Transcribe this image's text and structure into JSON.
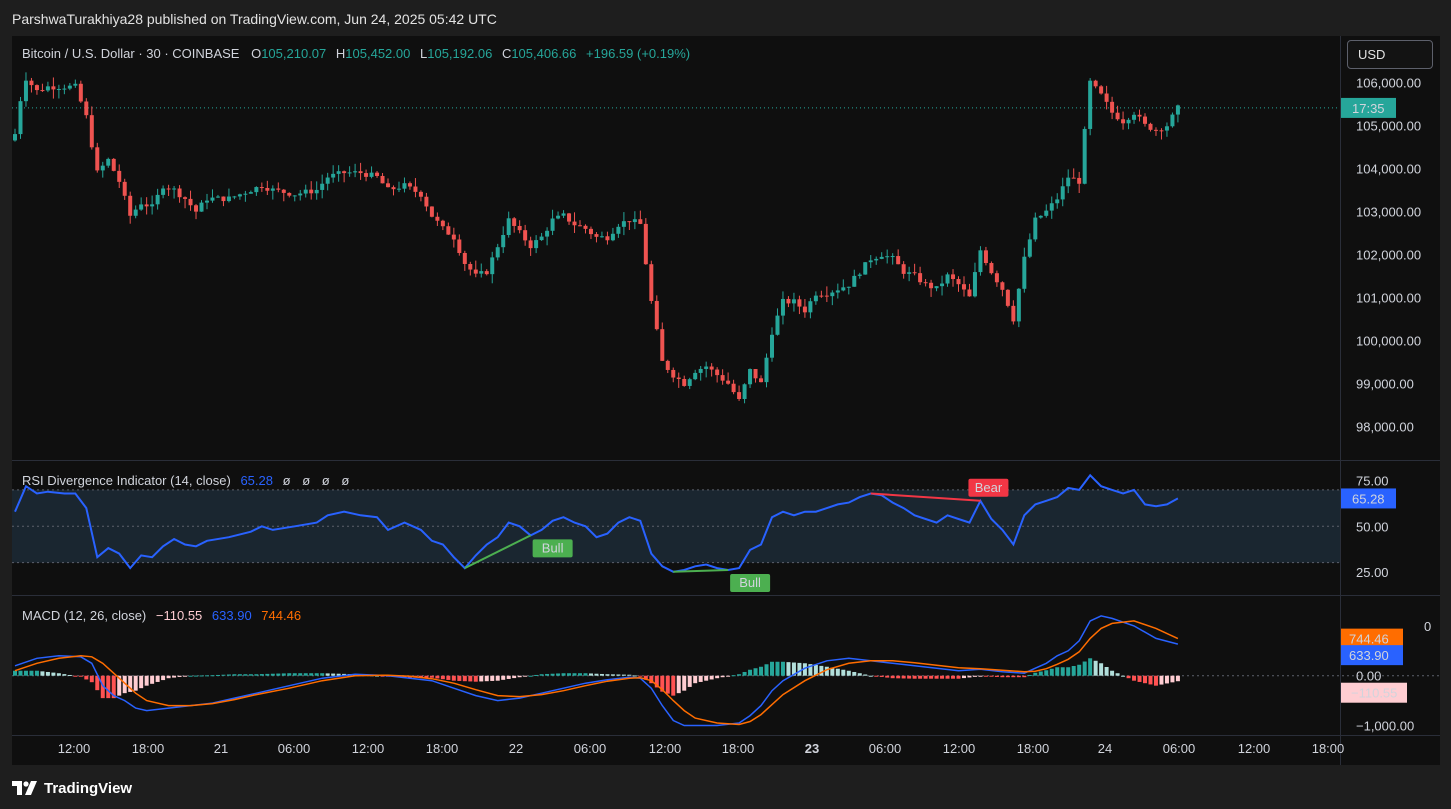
{
  "header": {
    "publish_text": "ParshwaTurakhiya28 published on TradingView.com, Jun 24, 2025 05:42 UTC"
  },
  "footer": {
    "brand": "TradingView"
  },
  "currency": "USD",
  "colors": {
    "up": "#26a69a",
    "down": "#ef5350",
    "rsi": "#2962ff",
    "macd": "#2962ff",
    "signal": "#ff6d00",
    "bull": "#4caf50",
    "bear": "#f23645"
  },
  "chart_data": [
    {
      "type": "candlestick",
      "title": "Bitcoin / U.S. Dollar · 30 · COINBASE",
      "ohlc_label": {
        "o_label": "O",
        "o": "105,210.07",
        "h_label": "H",
        "h": "105,452.00",
        "l_label": "L",
        "l": "105,192.06",
        "c_label": "C",
        "c": "105,406.66",
        "change": "+196.59 (+0.19%)"
      },
      "ylim": [
        97500,
        106800
      ],
      "y_ticks": [
        "106,000.00",
        "105,000.00",
        "104,000.00",
        "103,000.00",
        "102,000.00",
        "101,000.00",
        "100,000.00",
        "99,000.00",
        "98,000.00"
      ],
      "y_tick_values": [
        106000,
        105000,
        104000,
        103000,
        102000,
        101000,
        100000,
        99000,
        98000
      ],
      "last_price": 105407,
      "countdown_label": "17:35",
      "x_ticks": [
        "12:00",
        "18:00",
        "21",
        "06:00",
        "12:00",
        "18:00",
        "22",
        "06:00",
        "12:00",
        "18:00",
        "23",
        "06:00",
        "12:00",
        "18:00",
        "24",
        "06:00",
        "12:00",
        "18:00"
      ],
      "close_path": [
        [
          0,
          104800
        ],
        [
          1,
          105600
        ],
        [
          2,
          106100
        ],
        [
          4,
          105800
        ],
        [
          6,
          105900
        ],
        [
          9,
          105900
        ],
        [
          11,
          105900
        ],
        [
          13,
          105200
        ],
        [
          15,
          103900
        ],
        [
          17,
          104200
        ],
        [
          19,
          103700
        ],
        [
          21,
          102900
        ],
        [
          23,
          103200
        ],
        [
          25,
          103100
        ],
        [
          27,
          103600
        ],
        [
          29,
          103500
        ],
        [
          31,
          103300
        ],
        [
          33,
          103000
        ],
        [
          35,
          103300
        ],
        [
          39,
          103300
        ],
        [
          43,
          103500
        ],
        [
          45,
          103600
        ],
        [
          47,
          103500
        ],
        [
          51,
          103400
        ],
        [
          55,
          103500
        ],
        [
          57,
          103800
        ],
        [
          60,
          103900
        ],
        [
          63,
          103900
        ],
        [
          66,
          103800
        ],
        [
          68,
          103500
        ],
        [
          71,
          103600
        ],
        [
          74,
          103400
        ],
        [
          76,
          102900
        ],
        [
          78,
          102600
        ],
        [
          80,
          102400
        ],
        [
          82,
          101800
        ],
        [
          84,
          101500
        ],
        [
          86,
          101600
        ],
        [
          88,
          102200
        ],
        [
          90,
          102800
        ],
        [
          92,
          102500
        ],
        [
          94,
          102200
        ],
        [
          96,
          102400
        ],
        [
          98,
          102800
        ],
        [
          100,
          102900
        ],
        [
          102,
          102700
        ],
        [
          104,
          102600
        ],
        [
          106,
          102400
        ],
        [
          108,
          102400
        ],
        [
          110,
          102700
        ],
        [
          112,
          102800
        ],
        [
          114,
          102700
        ],
        [
          116,
          100900
        ],
        [
          118,
          99500
        ],
        [
          120,
          99200
        ],
        [
          122,
          99000
        ],
        [
          124,
          99300
        ],
        [
          126,
          99400
        ],
        [
          128,
          99200
        ],
        [
          130,
          99000
        ],
        [
          132,
          98600
        ],
        [
          134,
          99300
        ],
        [
          136,
          99000
        ],
        [
          138,
          100200
        ],
        [
          140,
          100900
        ],
        [
          142,
          100900
        ],
        [
          144,
          100700
        ],
        [
          146,
          101100
        ],
        [
          148,
          101100
        ],
        [
          150,
          101200
        ],
        [
          152,
          101300
        ],
        [
          154,
          101600
        ],
        [
          156,
          101900
        ],
        [
          158,
          102000
        ],
        [
          160,
          101900
        ],
        [
          162,
          101600
        ],
        [
          164,
          101500
        ],
        [
          166,
          101300
        ],
        [
          168,
          101200
        ],
        [
          170,
          101500
        ],
        [
          172,
          101300
        ],
        [
          174,
          101000
        ],
        [
          176,
          102100
        ],
        [
          178,
          101600
        ],
        [
          180,
          101200
        ],
        [
          182,
          100500
        ],
        [
          184,
          101900
        ],
        [
          186,
          102800
        ],
        [
          188,
          103000
        ],
        [
          190,
          103300
        ],
        [
          192,
          103800
        ],
        [
          194,
          103700
        ],
        [
          196,
          106000
        ],
        [
          198,
          105700
        ],
        [
          200,
          105300
        ],
        [
          202,
          105100
        ],
        [
          204,
          105300
        ],
        [
          206,
          105000
        ],
        [
          208,
          104900
        ],
        [
          210,
          105000
        ],
        [
          212,
          105400
        ]
      ]
    },
    {
      "type": "line",
      "title": "RSI Divergence Indicator (14, close)",
      "value_label": "65.28",
      "na_labels": [
        "ø",
        "ø",
        "ø",
        "ø"
      ],
      "ylim": [
        15,
        82
      ],
      "y_ticks": [
        "75.00",
        "50.00",
        "25.00"
      ],
      "y_tick_values": [
        75,
        50,
        25
      ],
      "band": [
        30,
        70
      ],
      "midline": 50,
      "last_value": 65.28,
      "series": [
        [
          0,
          58
        ],
        [
          2,
          72
        ],
        [
          4,
          68
        ],
        [
          6,
          69
        ],
        [
          9,
          68
        ],
        [
          11,
          68
        ],
        [
          13,
          60
        ],
        [
          15,
          33
        ],
        [
          17,
          38
        ],
        [
          19,
          35
        ],
        [
          21,
          27
        ],
        [
          23,
          34
        ],
        [
          25,
          33
        ],
        [
          27,
          39
        ],
        [
          29,
          43
        ],
        [
          31,
          40
        ],
        [
          33,
          39
        ],
        [
          35,
          42
        ],
        [
          39,
          44
        ],
        [
          43,
          47
        ],
        [
          45,
          50
        ],
        [
          47,
          48
        ],
        [
          51,
          50
        ],
        [
          55,
          52
        ],
        [
          57,
          56
        ],
        [
          60,
          58
        ],
        [
          63,
          56
        ],
        [
          66,
          55
        ],
        [
          68,
          48
        ],
        [
          71,
          52
        ],
        [
          74,
          48
        ],
        [
          76,
          42
        ],
        [
          78,
          40
        ],
        [
          80,
          33
        ],
        [
          82,
          27
        ],
        [
          84,
          34
        ],
        [
          86,
          40
        ],
        [
          88,
          44
        ],
        [
          90,
          52
        ],
        [
          92,
          50
        ],
        [
          94,
          45
        ],
        [
          96,
          48
        ],
        [
          98,
          53
        ],
        [
          100,
          55
        ],
        [
          102,
          52
        ],
        [
          104,
          50
        ],
        [
          106,
          44
        ],
        [
          108,
          46
        ],
        [
          110,
          52
        ],
        [
          112,
          55
        ],
        [
          114,
          53
        ],
        [
          116,
          35
        ],
        [
          118,
          28
        ],
        [
          120,
          25
        ],
        [
          122,
          26
        ],
        [
          124,
          28
        ],
        [
          126,
          29
        ],
        [
          128,
          27
        ],
        [
          130,
          26
        ],
        [
          132,
          27
        ],
        [
          134,
          37
        ],
        [
          136,
          40
        ],
        [
          138,
          55
        ],
        [
          140,
          58
        ],
        [
          142,
          56
        ],
        [
          144,
          58
        ],
        [
          146,
          58
        ],
        [
          148,
          60
        ],
        [
          150,
          62
        ],
        [
          152,
          63
        ],
        [
          154,
          66
        ],
        [
          156,
          68
        ],
        [
          158,
          67
        ],
        [
          160,
          63
        ],
        [
          162,
          60
        ],
        [
          164,
          56
        ],
        [
          166,
          54
        ],
        [
          168,
          52
        ],
        [
          170,
          56
        ],
        [
          172,
          54
        ],
        [
          174,
          52
        ],
        [
          176,
          64
        ],
        [
          178,
          54
        ],
        [
          180,
          48
        ],
        [
          182,
          40
        ],
        [
          184,
          56
        ],
        [
          186,
          62
        ],
        [
          188,
          64
        ],
        [
          190,
          66
        ],
        [
          192,
          71
        ],
        [
          194,
          70
        ],
        [
          196,
          78
        ],
        [
          198,
          72
        ],
        [
          200,
          70
        ],
        [
          202,
          68
        ],
        [
          204,
          70
        ],
        [
          206,
          62
        ],
        [
          208,
          61
        ],
        [
          210,
          62
        ],
        [
          212,
          65.28
        ]
      ],
      "divergences": [
        {
          "label": "Bull",
          "from": [
            82,
            27
          ],
          "to": [
            94,
            45
          ]
        },
        {
          "label": "Bull",
          "from": [
            120,
            25
          ],
          "to": [
            130,
            26
          ]
        },
        {
          "label": "Bear",
          "from": [
            156,
            68
          ],
          "to": [
            176,
            64
          ]
        }
      ]
    },
    {
      "type": "line+histogram",
      "title": "MACD (12, 26, close)",
      "legend_hist": "−110.55",
      "legend_macd": "633.90",
      "legend_signal": "744.46",
      "ylim": [
        -1150,
        1500
      ],
      "y_ticks": [
        "0.00",
        "−1,000.00"
      ],
      "y_tick_values": [
        0,
        -1000
      ],
      "clipped_tick_label": "0",
      "clipped_tick_value": 1000,
      "macd": [
        [
          0,
          200
        ],
        [
          4,
          350
        ],
        [
          8,
          400
        ],
        [
          12,
          380
        ],
        [
          14,
          250
        ],
        [
          16,
          -200
        ],
        [
          18,
          -400
        ],
        [
          20,
          -500
        ],
        [
          22,
          -650
        ],
        [
          24,
          -700
        ],
        [
          28,
          -650
        ],
        [
          32,
          -600
        ],
        [
          36,
          -550
        ],
        [
          40,
          -450
        ],
        [
          44,
          -350
        ],
        [
          50,
          -200
        ],
        [
          56,
          -50
        ],
        [
          62,
          30
        ],
        [
          68,
          0
        ],
        [
          72,
          -50
        ],
        [
          76,
          -100
        ],
        [
          80,
          -250
        ],
        [
          84,
          -400
        ],
        [
          88,
          -500
        ],
        [
          92,
          -450
        ],
        [
          96,
          -350
        ],
        [
          100,
          -250
        ],
        [
          104,
          -150
        ],
        [
          108,
          -80
        ],
        [
          112,
          -30
        ],
        [
          114,
          -50
        ],
        [
          116,
          -250
        ],
        [
          118,
          -600
        ],
        [
          120,
          -900
        ],
        [
          122,
          -1000
        ],
        [
          124,
          -1000
        ],
        [
          128,
          -1000
        ],
        [
          132,
          -950
        ],
        [
          134,
          -800
        ],
        [
          136,
          -600
        ],
        [
          138,
          -300
        ],
        [
          140,
          -100
        ],
        [
          144,
          150
        ],
        [
          148,
          300
        ],
        [
          152,
          350
        ],
        [
          156,
          300
        ],
        [
          160,
          250
        ],
        [
          164,
          200
        ],
        [
          168,
          150
        ],
        [
          172,
          100
        ],
        [
          176,
          130
        ],
        [
          180,
          80
        ],
        [
          184,
          50
        ],
        [
          186,
          150
        ],
        [
          188,
          250
        ],
        [
          190,
          400
        ],
        [
          192,
          500
        ],
        [
          194,
          700
        ],
        [
          196,
          1100
        ],
        [
          198,
          1200
        ],
        [
          200,
          1150
        ],
        [
          204,
          1000
        ],
        [
          208,
          750
        ],
        [
          212,
          633.9
        ]
      ],
      "signal": [
        [
          0,
          100
        ],
        [
          4,
          250
        ],
        [
          8,
          350
        ],
        [
          12,
          400
        ],
        [
          14,
          380
        ],
        [
          16,
          250
        ],
        [
          18,
          50
        ],
        [
          20,
          -150
        ],
        [
          22,
          -350
        ],
        [
          24,
          -500
        ],
        [
          28,
          -600
        ],
        [
          32,
          -600
        ],
        [
          36,
          -560
        ],
        [
          40,
          -480
        ],
        [
          44,
          -380
        ],
        [
          50,
          -250
        ],
        [
          56,
          -100
        ],
        [
          62,
          0
        ],
        [
          68,
          10
        ],
        [
          72,
          -10
        ],
        [
          76,
          -60
        ],
        [
          80,
          -150
        ],
        [
          84,
          -280
        ],
        [
          88,
          -400
        ],
        [
          92,
          -420
        ],
        [
          96,
          -380
        ],
        [
          100,
          -300
        ],
        [
          104,
          -200
        ],
        [
          108,
          -110
        ],
        [
          112,
          -50
        ],
        [
          114,
          -40
        ],
        [
          116,
          -100
        ],
        [
          118,
          -280
        ],
        [
          120,
          -500
        ],
        [
          122,
          -700
        ],
        [
          124,
          -850
        ],
        [
          128,
          -950
        ],
        [
          132,
          -980
        ],
        [
          134,
          -920
        ],
        [
          136,
          -780
        ],
        [
          138,
          -580
        ],
        [
          140,
          -380
        ],
        [
          144,
          -100
        ],
        [
          148,
          120
        ],
        [
          152,
          250
        ],
        [
          156,
          300
        ],
        [
          160,
          300
        ],
        [
          164,
          260
        ],
        [
          168,
          210
        ],
        [
          172,
          160
        ],
        [
          176,
          140
        ],
        [
          180,
          110
        ],
        [
          184,
          80
        ],
        [
          186,
          90
        ],
        [
          188,
          140
        ],
        [
          190,
          230
        ],
        [
          192,
          330
        ],
        [
          194,
          480
        ],
        [
          196,
          750
        ],
        [
          198,
          950
        ],
        [
          200,
          1050
        ],
        [
          204,
          1100
        ],
        [
          208,
          950
        ],
        [
          212,
          744.46
        ]
      ]
    }
  ]
}
